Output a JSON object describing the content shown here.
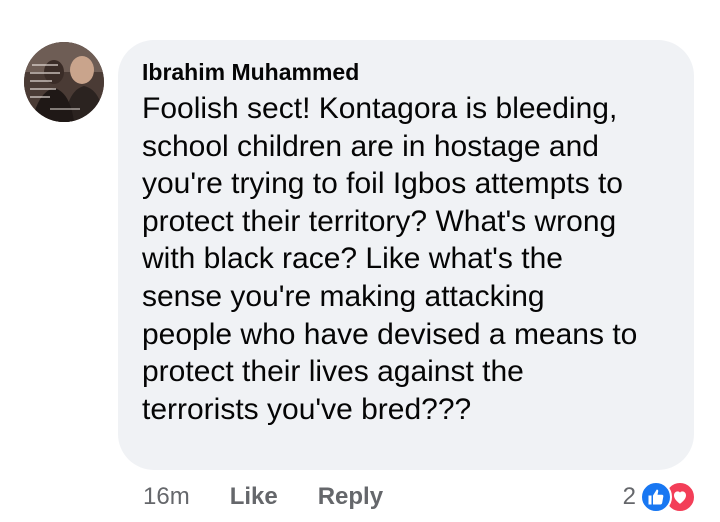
{
  "comment": {
    "author": "Ibrahim Muhammed",
    "text": "Foolish sect! Kontagora is bleeding,\nschool children are in hostage and\nyou're trying to foil Igbos attempts to\nprotect their territory? What's wrong\nwith black race? Like what's the\nsense you're making attacking\npeople who have devised a means to\nprotect their lives against the\nterrorists you've bred???",
    "timestamp": "16m",
    "like_label": "Like",
    "reply_label": "Reply",
    "reaction_count": "2",
    "reaction_icons": [
      "like-icon",
      "love-icon"
    ]
  },
  "colors": {
    "bubble_bg": "#f0f2f5",
    "meta_text": "#65676b",
    "like_blue": "#1877f2",
    "love_red": "#f33e58"
  }
}
